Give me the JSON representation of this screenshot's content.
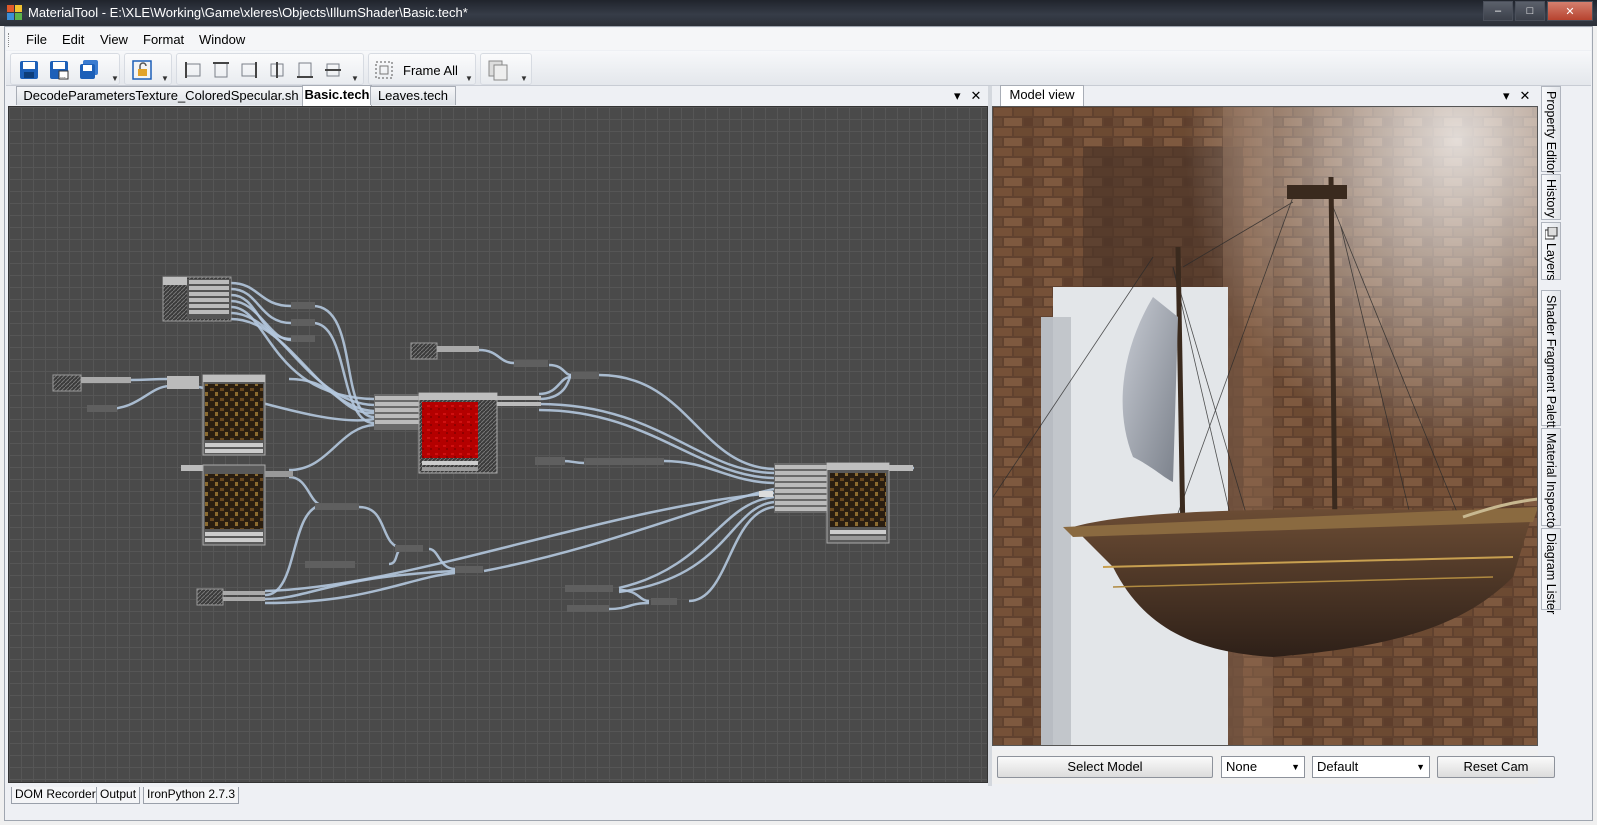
{
  "window": {
    "title": "MaterialTool - E:\\XLE\\Working\\Game\\xleres\\Objects\\IllumShader\\Basic.tech*",
    "minimize": "–",
    "maximize": "□",
    "close": "✕"
  },
  "menu": {
    "items": [
      "File",
      "Edit",
      "View",
      "Format",
      "Window"
    ]
  },
  "toolbar": {
    "frame_all_label": "Frame All",
    "icons": [
      "save-icon",
      "save-as-icon",
      "save-all-icon",
      "lock-icon",
      "align-left-icon",
      "align-top-icon",
      "align-right-icon",
      "align-center-icon",
      "align-bottom-icon",
      "align-middle-icon",
      "frame-all-icon",
      "copy-icon"
    ]
  },
  "left_tabs": {
    "tabs": [
      "DecodeParametersTexture_ColoredSpecular.sh",
      "Basic.tech",
      "Leaves.tech"
    ],
    "active": "Basic.tech",
    "dropdown": "▾",
    "close": "✕"
  },
  "right_tabs": {
    "tabs": [
      "Model view"
    ],
    "dropdown": "▾",
    "close": "✕"
  },
  "model_controls": {
    "select_model": "Select Model",
    "combo1": "None",
    "combo2": "Default",
    "reset_cam": "Reset Cam"
  },
  "side_tabs": [
    "Property Editor",
    "History",
    "Layers",
    "Shader Fragment Palette",
    "Material Inspector",
    "Diagram Lister"
  ],
  "status_tabs": [
    "DOM Recorder",
    "Output",
    "IronPython 2.7.3"
  ],
  "colors": {
    "canvas_bg": "#4a4a4a",
    "wire": "#b4c8de",
    "node_header": "#bfbfbf",
    "preview_red": "#b40000"
  }
}
